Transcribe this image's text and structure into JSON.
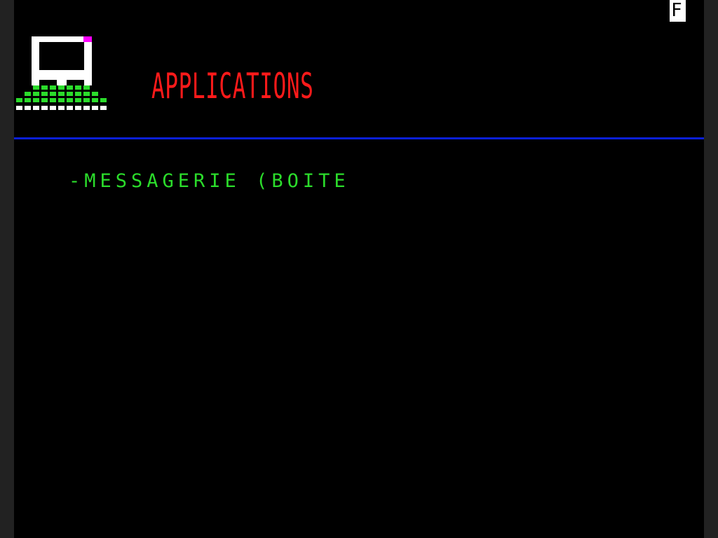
{
  "status": {
    "indicator": "F"
  },
  "header": {
    "title": "APPLICATIONS",
    "logo_icon": "terminal-computer-icon"
  },
  "colors": {
    "background": "#000000",
    "title": "#ff1a1a",
    "divider": "#0a1fd6",
    "menu_text": "#2bdc2b",
    "logo_frame": "#ffffff",
    "logo_accent": "#ff00ff",
    "logo_keyboard": "#2bdc2b"
  },
  "menu": {
    "items": [
      {
        "label": "-MESSAGERIE (BOITE"
      }
    ]
  }
}
